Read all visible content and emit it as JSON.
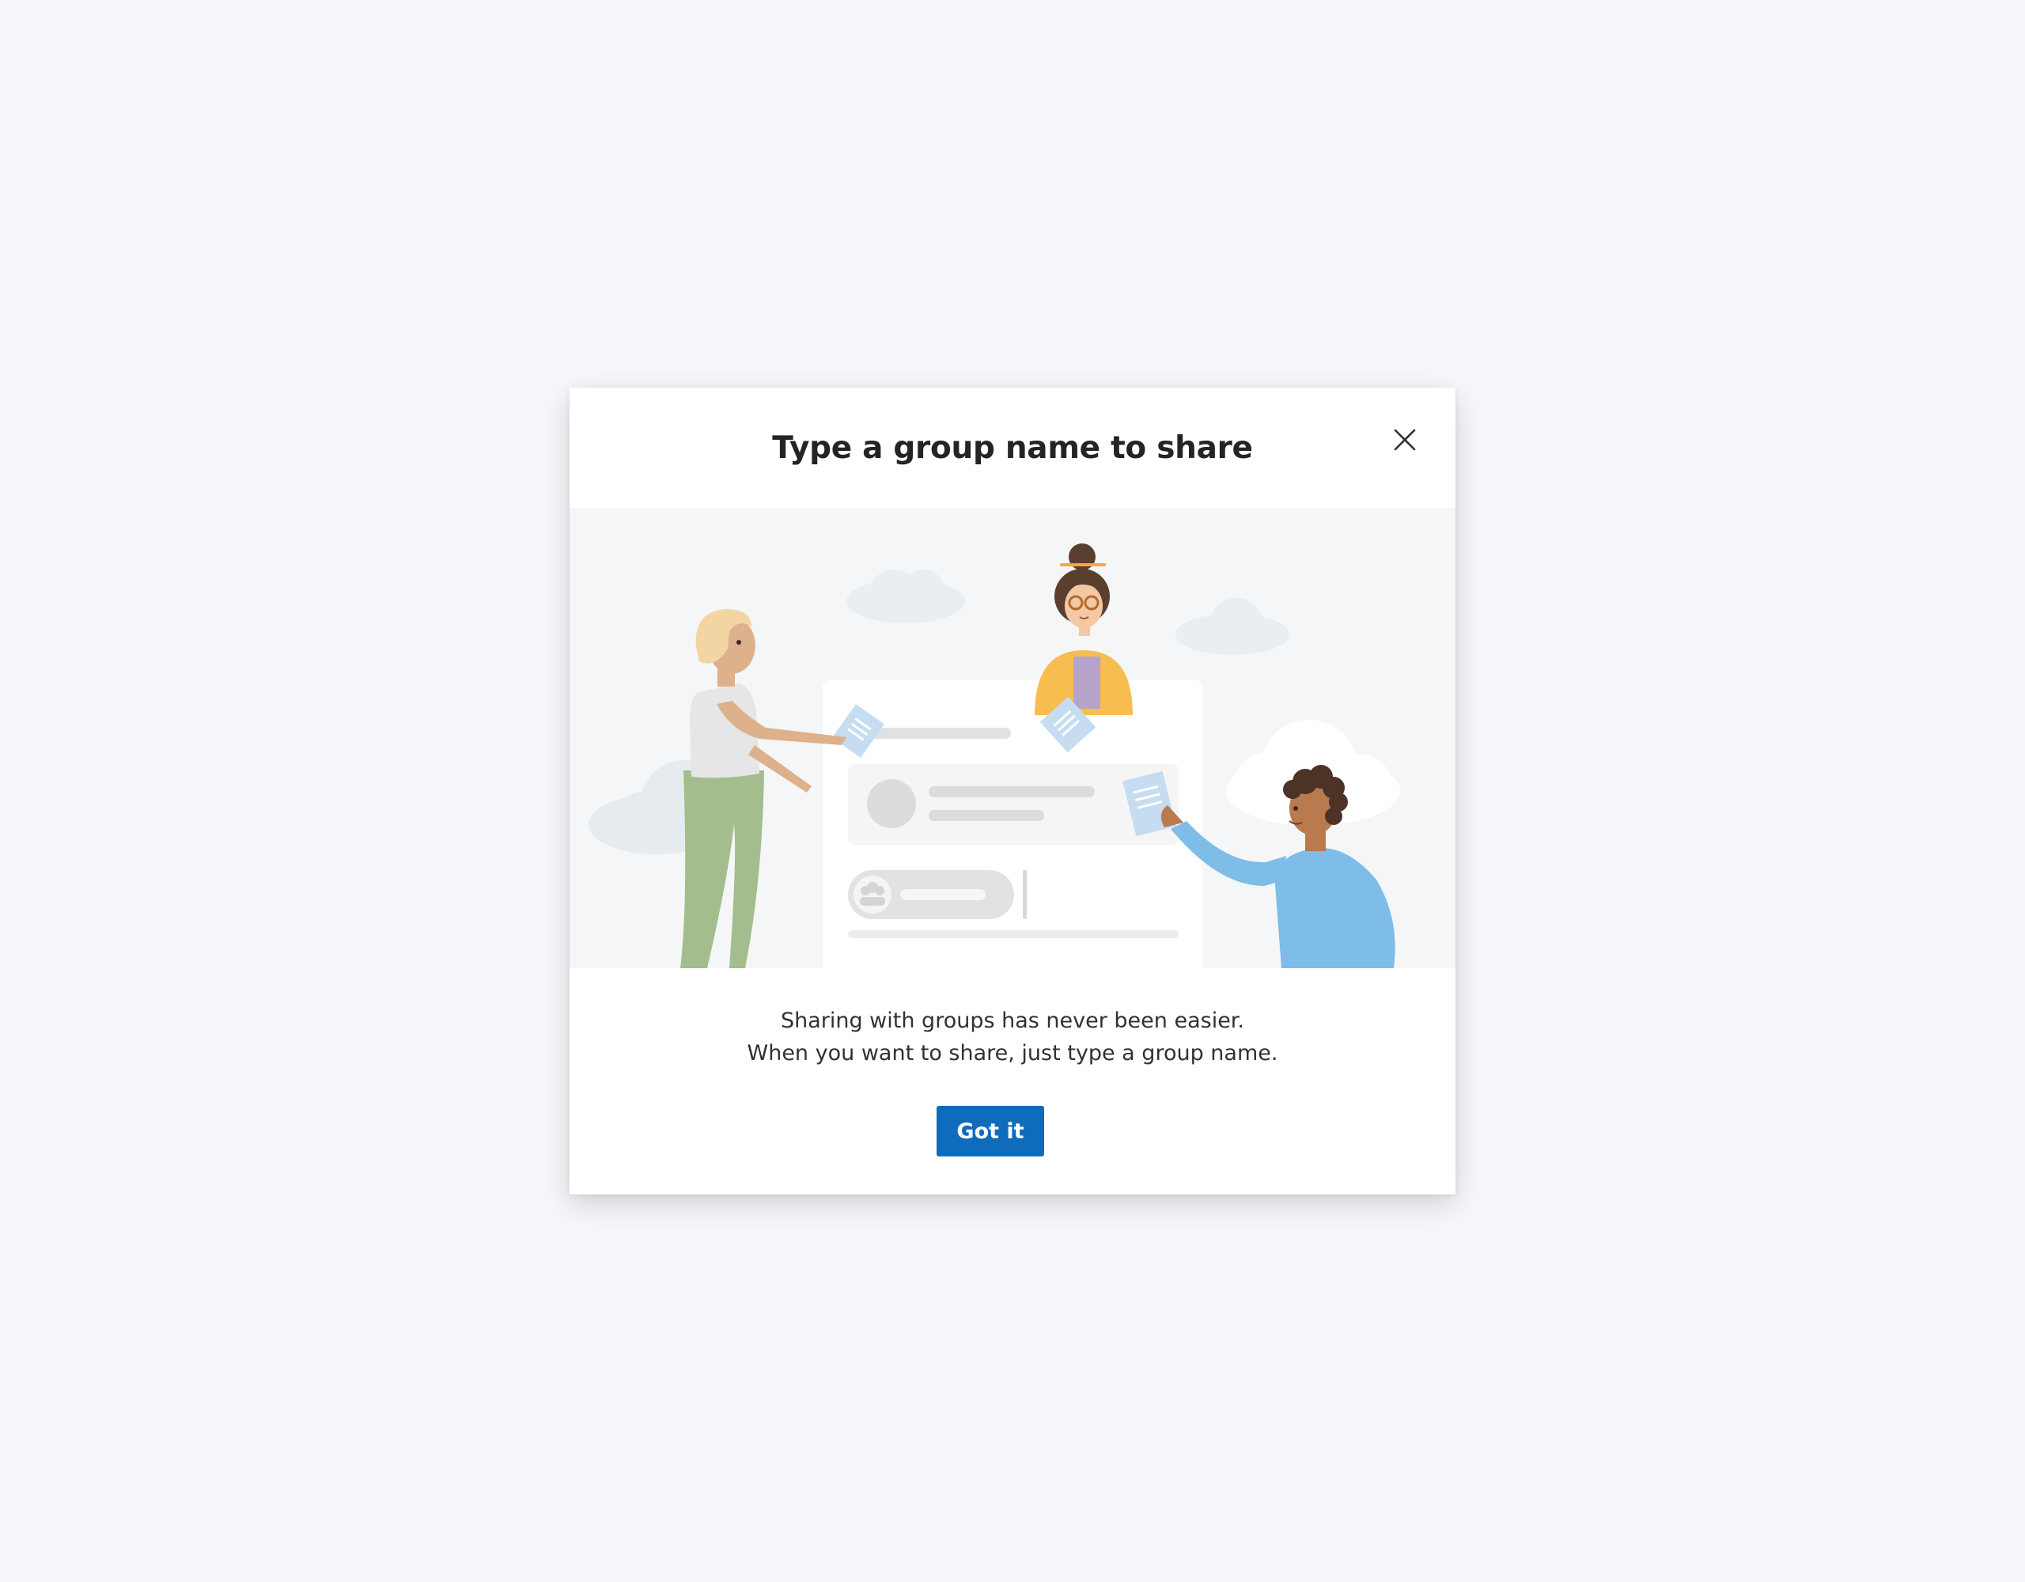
{
  "dialog": {
    "title": "Type a group name to share",
    "close_icon": "close-icon",
    "message_lines": [
      "Sharing with groups has never been easier.",
      "When you want to share, just type a group name."
    ],
    "primary_button_label": "Got it"
  },
  "illustration": {
    "subject": "three people sharing documents around a share card",
    "icons": [
      "cloud-icon",
      "person-icon",
      "document-icon",
      "group-icon"
    ]
  },
  "colors": {
    "page_background": "#f8f8fc",
    "dialog_background": "#ffffff",
    "illustration_background": "#f4f6f8",
    "accent": "#0f6cbd",
    "title_text": "#252423",
    "body_text": "#323130"
  }
}
